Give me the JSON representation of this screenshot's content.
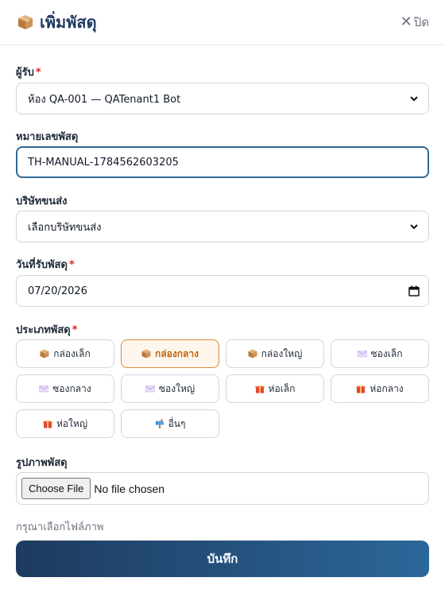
{
  "header": {
    "title": "เพิ่มพัสดุ",
    "title_icon": "package-icon",
    "close_label": "ปิด"
  },
  "form": {
    "recipient": {
      "label": "ผู้รับ",
      "required_mark": "*",
      "value": "ห้อง QA-001 — QATenant1 Bot"
    },
    "tracking": {
      "label": "หมายเลขพัสดุ",
      "value": "TH-MANUAL-1784562603205"
    },
    "carrier": {
      "label": "บริษัทขนส่ง",
      "value": "เลือกบริษัทขนส่ง"
    },
    "received_date": {
      "label": "วันที่รับพัสดุ",
      "required_mark": "*",
      "value": "07/20/2026"
    },
    "parcel_type": {
      "label": "ประเภทพัสดุ",
      "required_mark": "*",
      "selected": "กล่องกลาง",
      "options": [
        {
          "label": "กล่องเล็ก",
          "icon": "box-icon"
        },
        {
          "label": "กล่องกลาง",
          "icon": "box-icon"
        },
        {
          "label": "กล่องใหญ่",
          "icon": "box-icon"
        },
        {
          "label": "ซองเล็ก",
          "icon": "envelope-icon"
        },
        {
          "label": "ซองกลาง",
          "icon": "envelope-icon"
        },
        {
          "label": "ซองใหญ่",
          "icon": "envelope-icon"
        },
        {
          "label": "ห่อเล็ก",
          "icon": "gift-icon"
        },
        {
          "label": "ห่อกลาง",
          "icon": "gift-icon"
        },
        {
          "label": "ห่อใหญ่",
          "icon": "gift-icon"
        },
        {
          "label": "อื่นๆ",
          "icon": "mailbox-icon"
        }
      ]
    },
    "photo": {
      "label": "รูปภาพพัสดุ",
      "button_label": "Choose File",
      "status": "No file chosen",
      "hint": "กรุณาเลือกไฟล์ภาพ"
    },
    "submit_label": "บันทึก"
  },
  "colors": {
    "brand": "#1e3a5f",
    "accent": "#2b6799",
    "selected_border": "#d98b3a",
    "selected_bg": "#fff7ed",
    "required": "#dc2626"
  }
}
